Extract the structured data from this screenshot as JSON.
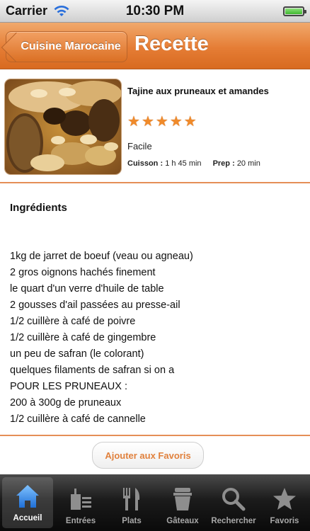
{
  "status": {
    "carrier": "Carrier",
    "time": "10:30 PM",
    "battery_level": 1.0
  },
  "nav": {
    "back_label": "Cuisine Marocaine",
    "title": "Recette"
  },
  "recipe": {
    "name": "Tajine aux pruneaux et amandes",
    "rating": 5,
    "rating_max": 5,
    "difficulty": "Facile",
    "cuisson_label": "Cuisson :",
    "cuisson_value": "1 h 45 min",
    "prep_label": "Prep :",
    "prep_value": "20 min",
    "photo_icon": "tajine-photo"
  },
  "ingredients": {
    "title": "Ingrédients",
    "items": [
      "1kg de jarret de boeuf (veau ou agneau)",
      "2 gros oignons hachés finement",
      "le quart d'un verre d'huile de table",
      "2 gousses d'ail passées au presse-ail",
      "1/2 cuillère à café de poivre",
      "1/2 cuillère à café de gingembre",
      "un peu de safran (le colorant)",
      "quelques filaments de safran si on a",
      "POUR LES PRUNEAUX :",
      "200 à 300g de pruneaux",
      "1/2 cuillère à café de cannelle"
    ]
  },
  "favorites_button": "Ajouter aux Favoris",
  "tabs": [
    {
      "label": "Accueil",
      "icon": "home-icon",
      "active": true
    },
    {
      "label": "Entrées",
      "icon": "drink-icon",
      "active": false
    },
    {
      "label": "Plats",
      "icon": "utensils-icon",
      "active": false
    },
    {
      "label": "Gâteaux",
      "icon": "cake-icon",
      "active": false
    },
    {
      "label": "Rechercher",
      "icon": "search-icon",
      "active": false
    },
    {
      "label": "Favoris",
      "icon": "star-icon",
      "active": false
    }
  ],
  "colors": {
    "accent": "#e57d35",
    "star": "#f08a2a",
    "favorites_text": "#e1813d"
  }
}
